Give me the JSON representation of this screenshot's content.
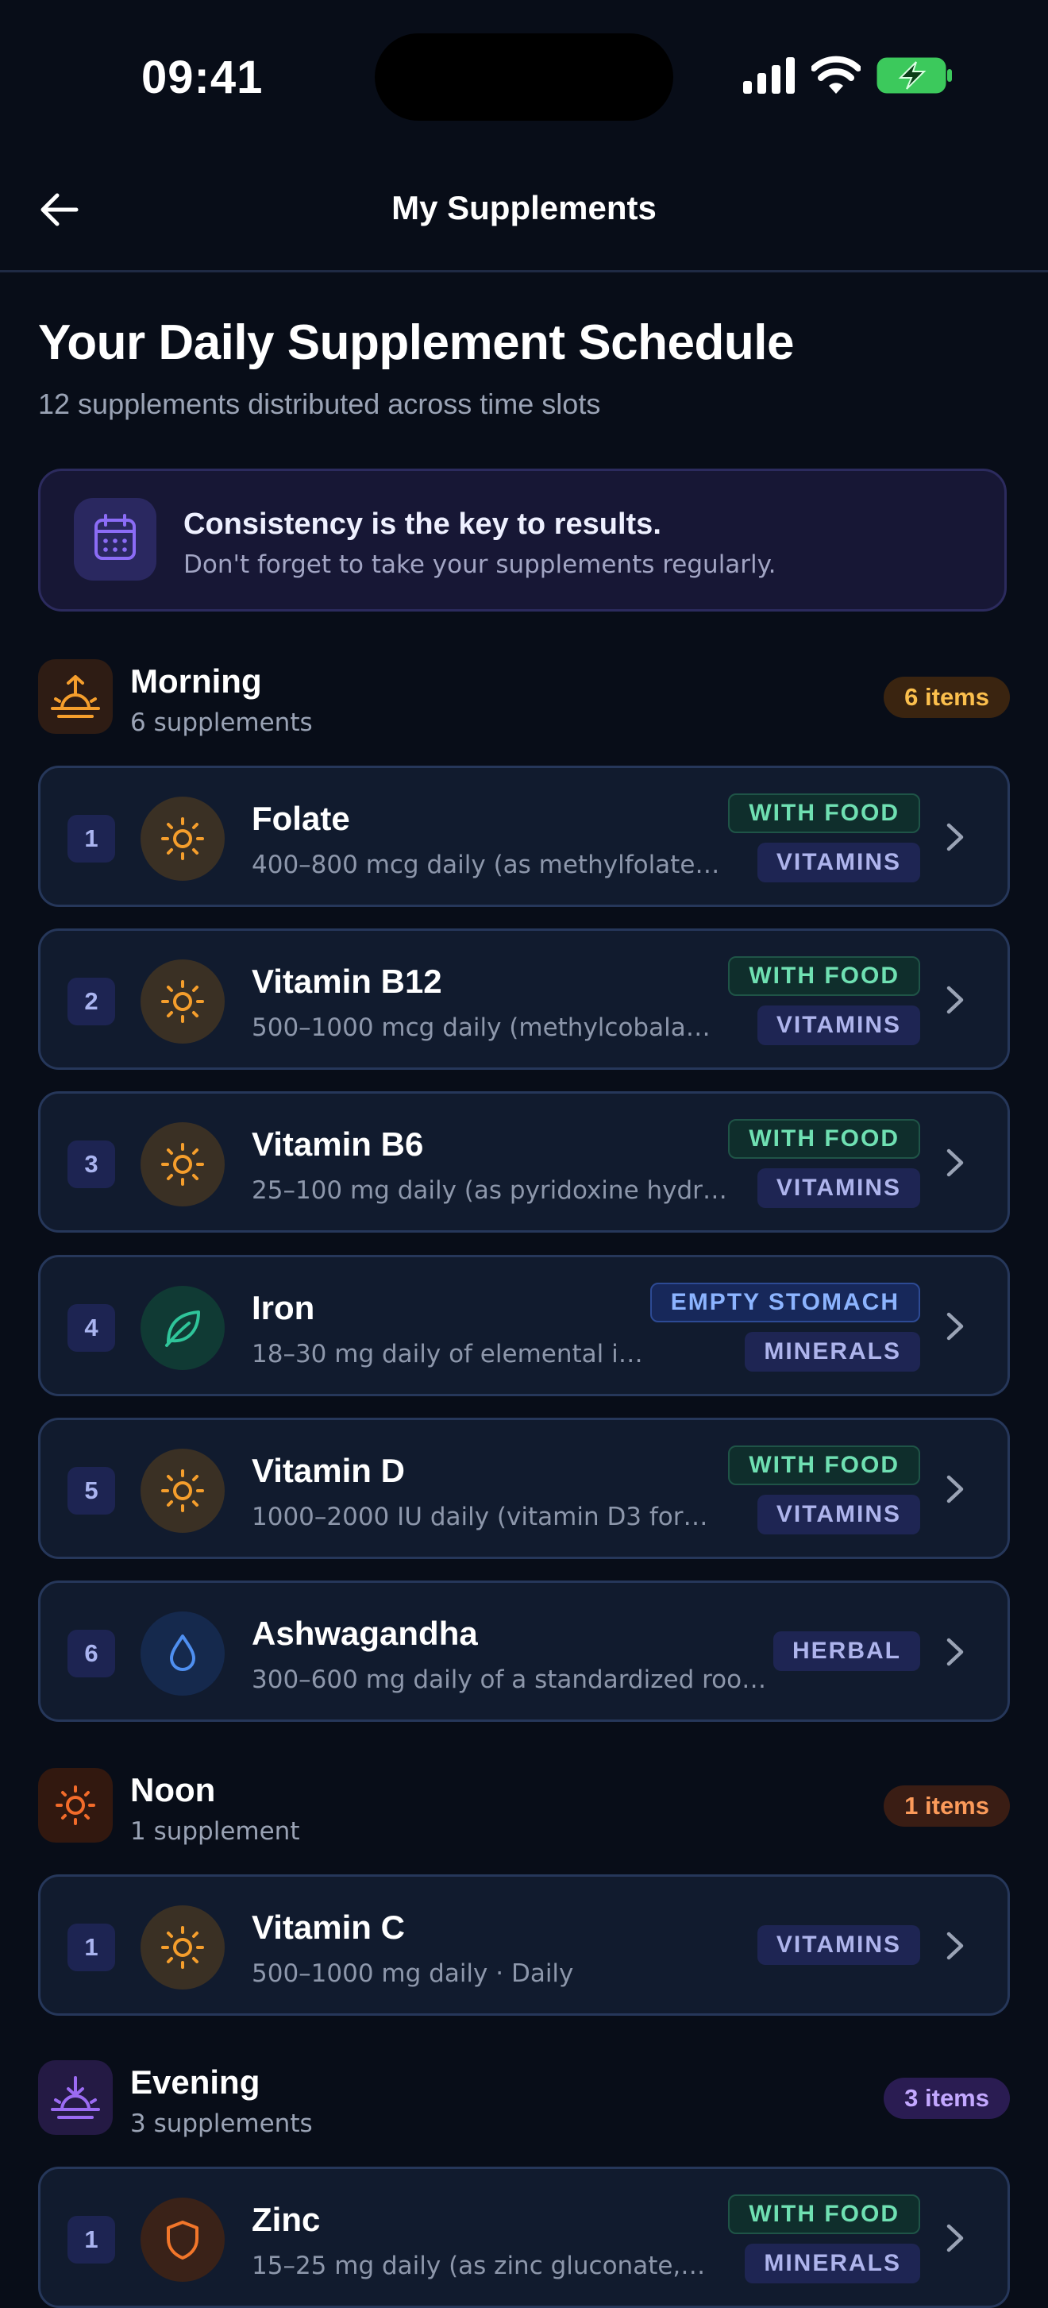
{
  "status": {
    "time": "09:41"
  },
  "nav": {
    "title": "My Supplements"
  },
  "header": {
    "title": "Your Daily Supplement Schedule",
    "subtitle": "12 supplements distributed across time slots"
  },
  "banner": {
    "icon": "calendar-icon",
    "title": "Consistency is the key to results.",
    "subtitle": "Don't forget to take your supplements regularly."
  },
  "colors": {
    "background": "#080d18",
    "card": "#111b2e",
    "morning": "#f59e2c",
    "noon": "#f26b2a",
    "evening": "#9b6bf2",
    "with_food": "#6fe0b2",
    "empty_stomach": "#8cb4ff"
  },
  "sections": [
    {
      "id": "morning",
      "icon": "sunrise-icon",
      "title": "Morning",
      "subtitle": "6 supplements",
      "count": "6 items",
      "items": [
        {
          "num": "1",
          "icon": "sun-icon",
          "name": "Folate",
          "desc": "400–800 mcg daily (as methylfolate…",
          "tags": [
            "WITH FOOD",
            "VITAMINS"
          ]
        },
        {
          "num": "2",
          "icon": "sun-icon",
          "name": "Vitamin B12",
          "desc": "500–1000 mcg daily (methylcobala…",
          "tags": [
            "WITH FOOD",
            "VITAMINS"
          ]
        },
        {
          "num": "3",
          "icon": "sun-icon",
          "name": "Vitamin B6",
          "desc": "25–100 mg daily (as pyridoxine hydr…",
          "tags": [
            "WITH FOOD",
            "VITAMINS"
          ]
        },
        {
          "num": "4",
          "icon": "leaf-icon",
          "name": "Iron",
          "desc": "18–30 mg daily of elemental i…",
          "tags": [
            "EMPTY STOMACH",
            "MINERALS"
          ]
        },
        {
          "num": "5",
          "icon": "sun-icon",
          "name": "Vitamin D",
          "desc": "1000–2000 IU daily (vitamin D3 for…",
          "tags": [
            "WITH FOOD",
            "VITAMINS"
          ]
        },
        {
          "num": "6",
          "icon": "droplet-icon",
          "name": "Ashwagandha",
          "desc": "300–600 mg daily of a standardized roo…",
          "tags": [
            "HERBAL"
          ]
        }
      ]
    },
    {
      "id": "noon",
      "icon": "sun-icon",
      "title": "Noon",
      "subtitle": "1 supplement",
      "count": "1 items",
      "items": [
        {
          "num": "1",
          "icon": "sun-icon",
          "name": "Vitamin C",
          "desc": "500–1000 mg daily · Daily",
          "tags": [
            "VITAMINS"
          ]
        }
      ]
    },
    {
      "id": "evening",
      "icon": "sunset-icon",
      "title": "Evening",
      "subtitle": "3 supplements",
      "count": "3 items",
      "items": [
        {
          "num": "1",
          "icon": "shield-icon",
          "name": "Zinc",
          "desc": "15–25 mg daily (as zinc gluconate,…",
          "tags": [
            "WITH FOOD",
            "MINERALS"
          ]
        }
      ]
    }
  ]
}
